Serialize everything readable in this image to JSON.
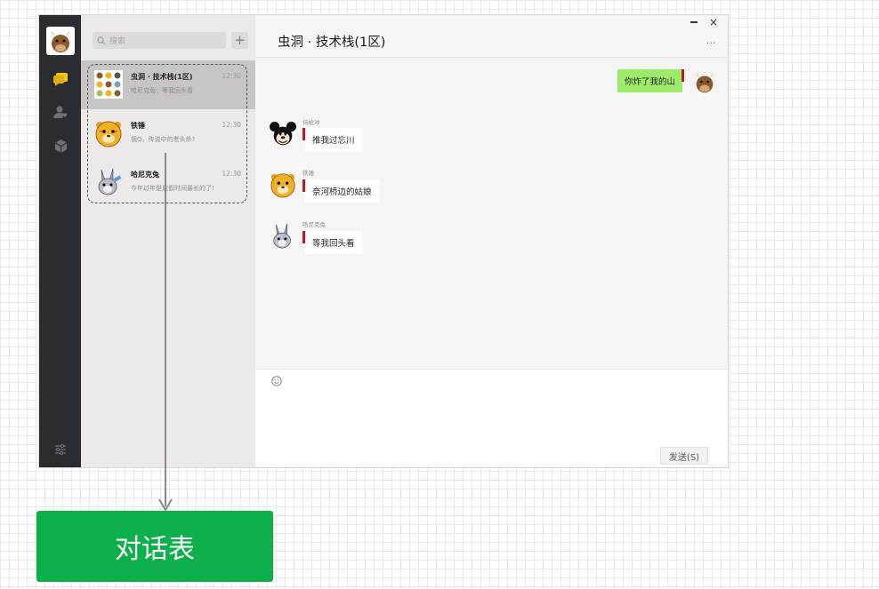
{
  "window": {
    "title": "虫洞 · 技术栈(1区)",
    "more_label": "···",
    "close_label": "×"
  },
  "search": {
    "placeholder": "搜索",
    "add_label": "+"
  },
  "chats": [
    {
      "name": "虫洞 · 技术栈(1区)",
      "preview": "哈尼克兔：等我回头看",
      "time": "12:30",
      "avatar": "group-avatar",
      "active": true
    },
    {
      "name": "铁锤",
      "preview": "我Q，传说中的老头杀?",
      "time": "12:30",
      "avatar": "tiger-avatar",
      "active": false
    },
    {
      "name": "哈尼克兔",
      "preview": "今年过年是放假时间最长的了!",
      "time": "12:30",
      "avatar": "rabbit-avatar",
      "active": false
    }
  ],
  "messages": [
    {
      "mine": true,
      "text": "你炸了我的山",
      "avatar": "cow-avatar"
    },
    {
      "mine": false,
      "sender": "持枪冲",
      "text": "推我过忘川",
      "avatar": "mickey-avatar"
    },
    {
      "mine": false,
      "sender": "铁锤",
      "text": "奈河桥边的姑娘",
      "avatar": "tiger-avatar"
    },
    {
      "mine": false,
      "sender": "哈尼克兔",
      "text": "等我回头看",
      "avatar": "rabbit-avatar"
    }
  ],
  "input": {
    "send_label": "发送(S)"
  },
  "annotation": {
    "label": "对话表"
  },
  "colors": {
    "sidebar": "#2b2c30",
    "accent_green": "#0cb04b",
    "mine_bubble": "#9eea6a",
    "chat_icon_active": "#f5c518",
    "marker_red": "#c8181e"
  }
}
